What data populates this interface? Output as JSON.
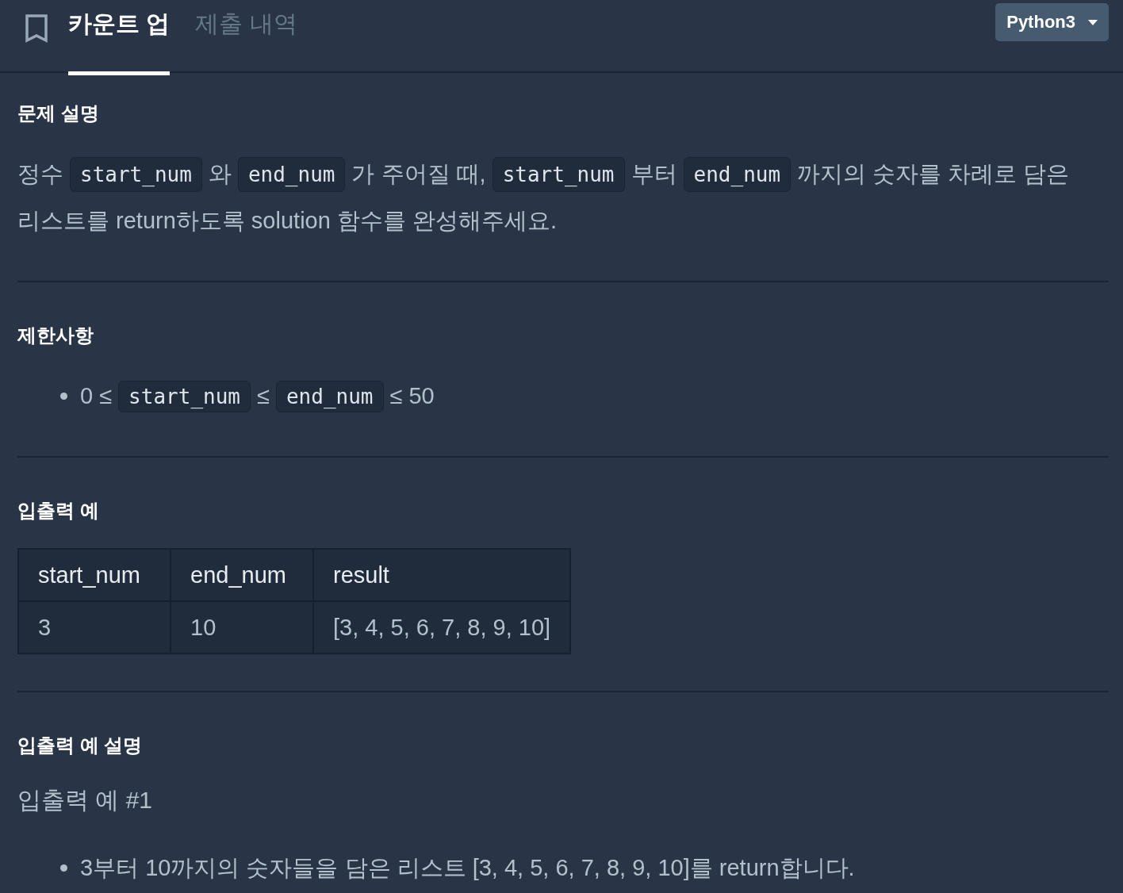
{
  "header": {
    "tabs": [
      {
        "label": "카운트 업",
        "selected": true
      },
      {
        "label": "제출 내역",
        "selected": false
      }
    ],
    "language_dropdown": {
      "value": "Python3"
    }
  },
  "sections": [
    {
      "kind": "paragraph",
      "title": "문제 설명",
      "lines": [
        [
          {
            "kind": "text",
            "text": "정수"
          },
          {
            "kind": "code",
            "text": "start_num"
          },
          {
            "kind": "text",
            "text": "와"
          },
          {
            "kind": "code",
            "text": "end_num"
          },
          {
            "kind": "text",
            "text": "가 주어질 때,"
          },
          {
            "kind": "code",
            "text": "start_num"
          },
          {
            "kind": "text",
            "text": "부터"
          },
          {
            "kind": "code",
            "text": "end_num"
          },
          {
            "kind": "text",
            "text": "까지의 숫자를 차례로 담은"
          }
        ],
        [
          {
            "kind": "text",
            "text": "리스트를 return하도록 solution 함수를 완성해주세요."
          }
        ]
      ]
    },
    {
      "kind": "list",
      "title": "제한사항",
      "items": [
        [
          {
            "kind": "text",
            "text": "0 ≤"
          },
          {
            "kind": "code",
            "text": "start_num"
          },
          {
            "kind": "text",
            "text": "≤"
          },
          {
            "kind": "code",
            "text": "end_num"
          },
          {
            "kind": "text",
            "text": "≤ 50"
          }
        ]
      ]
    },
    {
      "kind": "table",
      "title": "입출력 예",
      "columns": [
        "start_num",
        "end_num",
        "result"
      ],
      "rows": [
        [
          "3",
          "10",
          "[3, 4, 5, 6, 7, 8, 9, 10]"
        ]
      ]
    },
    {
      "kind": "examples",
      "title": "입출력 예 설명",
      "subtitle": "입출력 예 #1",
      "items": [
        [
          {
            "kind": "text",
            "text": "3부터 10까지의 숫자들을 담은 리스트 [3, 4, 5, 6, 7, 8, 9, 10]를 return합니다."
          }
        ]
      ]
    }
  ]
}
